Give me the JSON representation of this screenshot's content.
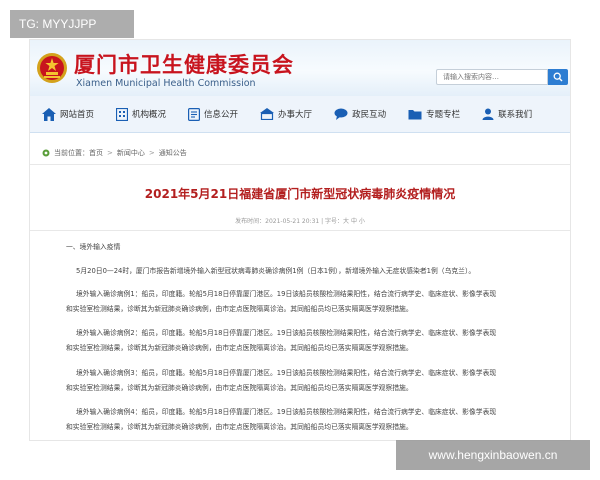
{
  "watermark_top": "TG: MYYJJPP",
  "watermark_bottom": "www.hengxinbaowen.cn",
  "header": {
    "title_cn": "厦门市卫生健康委员会",
    "title_en": "Xiamen  Municipal Health Commission",
    "search_placeholder": "请输入搜索内容…",
    "accent_color": "#c8141e",
    "search_button_color": "#2d7dd2"
  },
  "nav": {
    "items": [
      {
        "label": "网站首页",
        "icon": "home-icon"
      },
      {
        "label": "机构概况",
        "icon": "building-icon"
      },
      {
        "label": "信息公开",
        "icon": "document-icon"
      },
      {
        "label": "办事大厅",
        "icon": "hall-icon"
      },
      {
        "label": "政民互动",
        "icon": "chat-icon"
      },
      {
        "label": "专题专栏",
        "icon": "folder-icon"
      },
      {
        "label": "联系我们",
        "icon": "contact-icon"
      }
    ]
  },
  "breadcrumb": {
    "prefix": "当前位置：",
    "items": [
      "首页",
      "新闻中心",
      "通知公告"
    ],
    "separator": ">"
  },
  "article": {
    "title": "2021年5月21日福建省厦门市新型冠状病毒肺炎疫情情况",
    "meta": "发布时间：2021-05-21 20:31  |  字号：大  中  小",
    "heading": "一、境外输入疫情",
    "paragraphs": [
      "5月20日0—24时，厦门市报告新增境外输入新型冠状病毒肺炎确诊病例1例（日本1例），新增境外输入无症状感染者1例（乌克兰）。",
      "境外输入确诊病例1：船员，印度籍。轮船5月18日停靠厦门港区。19日该船员核酸检测结果阳性，结合流行病学史、临床症状、影像学表现",
      "和实验室检测结果，诊断其为新冠肺炎确诊病例，由市定点医院隔离诊治。其同船船员均已落实隔离医学观察措施。",
      "境外输入确诊病例2：船员，印度籍。轮船5月18日停靠厦门港区。19日该船员核酸检测结果阳性，结合流行病学史、临床症状、影像学表现",
      "和实验室检测结果，诊断其为新冠肺炎确诊病例，由市定点医院隔离诊治。其同船船员均已落实隔离医学观察措施。",
      "境外输入确诊病例3：船员，印度籍。轮船5月18日停靠厦门港区。19日该船员核酸检测结果阳性，结合流行病学史、临床症状、影像学表现",
      "和实验室检测结果，诊断其为新冠肺炎确诊病例，由市定点医院隔离诊治。其同船船员均已落实隔离医学观察措施。",
      "境外输入确诊病例4：船员，印度籍。轮船5月18日停靠厦门港区。19日该船员核酸检测结果阳性，结合流行病学史、临床症状、影像学表现",
      "和实验室检测结果，诊断其为新冠肺炎确诊病例，由市定点医院隔离诊治。其同船船员均已落实隔离医学观察措施。"
    ]
  }
}
